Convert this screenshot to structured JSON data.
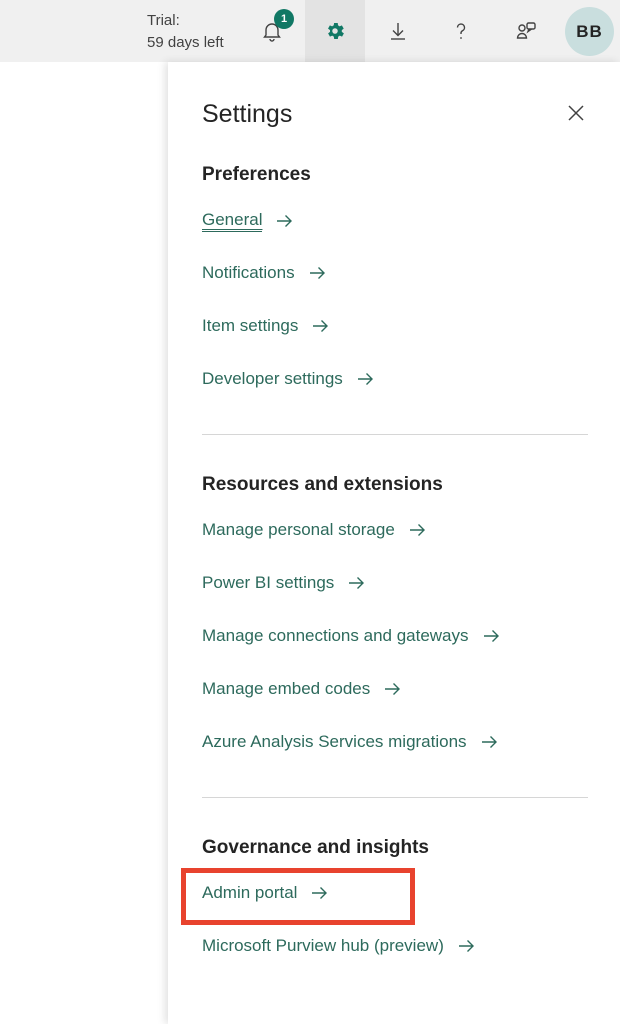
{
  "topbar": {
    "trial_label": "Trial:",
    "trial_days": "59 days left",
    "notifications_count": "1",
    "icons": [
      "bell-icon",
      "gear-icon",
      "download-icon",
      "help-icon",
      "share-icon"
    ],
    "avatar_initials": "BB"
  },
  "settings": {
    "title": "Settings",
    "sections": [
      {
        "title": "Preferences",
        "links": [
          "General",
          "Notifications",
          "Item settings",
          "Developer settings"
        ]
      },
      {
        "title": "Resources and extensions",
        "links": [
          "Manage personal storage",
          "Power BI settings",
          "Manage connections and gateways",
          "Manage embed codes",
          "Azure Analysis Services migrations"
        ]
      },
      {
        "title": "Governance and insights",
        "links": [
          "Admin portal",
          "Microsoft Purview hub (preview)"
        ]
      }
    ],
    "current_link": "General",
    "highlighted_link": "Admin portal"
  },
  "colors": {
    "accent": "#117865",
    "link": "#2d6a5c",
    "highlight": "#e8432e"
  }
}
